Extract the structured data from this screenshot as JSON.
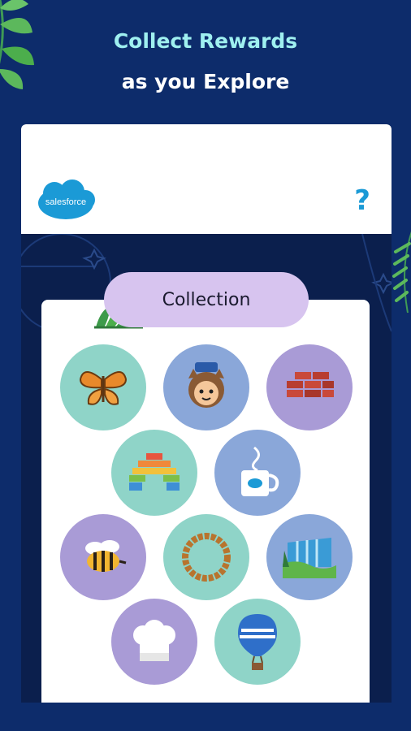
{
  "promo": {
    "line1": "Collect Rewards",
    "line2": "as you Explore"
  },
  "header": {
    "logo_text": "salesforce",
    "help_label": "?"
  },
  "collection": {
    "tab_label": "Collection",
    "badges": [
      {
        "name": "butterfly",
        "color": "teal"
      },
      {
        "name": "astro-character",
        "color": "blue"
      },
      {
        "name": "bricks",
        "color": "purple"
      },
      {
        "name": "rainbow-blocks",
        "color": "teal"
      },
      {
        "name": "coffee-mug",
        "color": "blue"
      },
      {
        "name": "bee",
        "color": "purple"
      },
      {
        "name": "wreath-ring",
        "color": "teal"
      },
      {
        "name": "waterfall-landscape",
        "color": "blue"
      },
      {
        "name": "chef-hat",
        "color": "purple"
      },
      {
        "name": "hot-air-balloon",
        "color": "teal"
      }
    ]
  },
  "colors": {
    "background": "#0d2c6b",
    "title_accent": "#9ff0f0",
    "tab": "#d7c4ef",
    "teal_badge": "#8fd4c8",
    "blue_badge": "#8aa7d9",
    "purple_badge": "#a99bd6",
    "salesforce_blue": "#1b9ad6"
  }
}
